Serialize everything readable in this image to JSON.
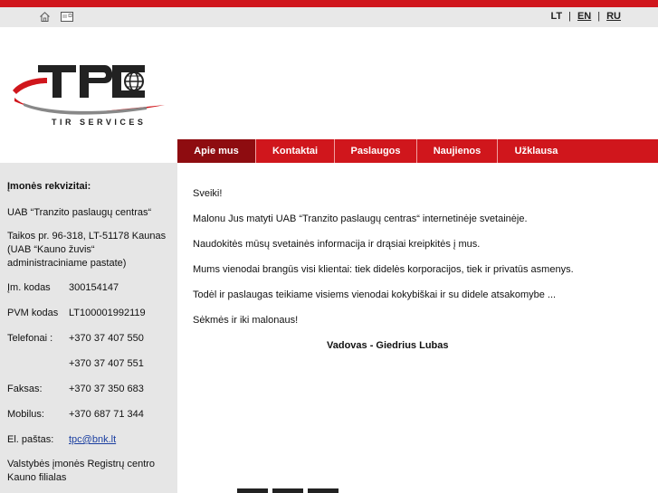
{
  "topbar": {
    "icons": [
      "home-icon",
      "mail-icon"
    ],
    "languages": [
      {
        "label": "LT"
      },
      {
        "label": "EN"
      },
      {
        "label": "RU"
      }
    ],
    "separator": "|"
  },
  "logo": {
    "brand": "TPC",
    "tagline": "TIR SERVICES"
  },
  "nav": {
    "items": [
      {
        "label": "Apie mus"
      },
      {
        "label": "Kontaktai"
      },
      {
        "label": "Paslaugos"
      },
      {
        "label": "Naujienos"
      },
      {
        "label": "Užklausa"
      }
    ]
  },
  "sidebar": {
    "title": "Įmonės rekvizitai:",
    "company": "UAB “Tranzito paslaugų centras“",
    "address": "Taikos pr. 96-318, LT-51178 Kaunas (UAB “Kauno žuvis“ administraciniame pastate)",
    "rows": [
      {
        "label": "Įm. kodas",
        "value": "300154147"
      },
      {
        "label": "PVM kodas",
        "value": "LT100001992119"
      },
      {
        "label": "Telefonai :",
        "value": "+370 37 407 550"
      },
      {
        "label": "",
        "value": "+370 37 407 551"
      },
      {
        "label": "Faksas:",
        "value": "+370 37 350 683"
      },
      {
        "label": "Mobilus:",
        "value": "+370 687 71 344"
      },
      {
        "label": "El. paštas:",
        "value": "tpc@bnk.lt"
      }
    ],
    "registry": "Valstybės įmonės Registrų centro Kauno filialas"
  },
  "content": {
    "paragraphs": [
      "Sveiki!",
      "Malonu Jus matyti UAB “Tranzito paslaugų centras“ internetinėje svetainėje.",
      "Naudokitės mūsų svetainės informacija ir drąsiai kreipkitės į mus.",
      "Mums vienodai brangūs visi klientai: tiek didelės korporacijos, tiek ir privatūs asmenys.",
      "Todėl ir paslaugas teikiame visiems vienodai kokybiškai ir su didele atsakomybe ...",
      "Sėkmės ir iki malonaus!"
    ],
    "signature": "Vadovas - Giedrius Lubas"
  },
  "colors": {
    "brand_red": "#d0161c",
    "active_tab": "#8e0c10",
    "sidebar_bg": "#e6e6e6",
    "topbar_bg": "#e8e8e8"
  }
}
